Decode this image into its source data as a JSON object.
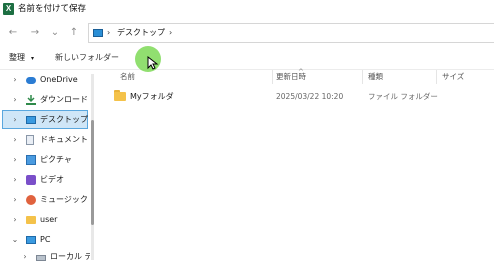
{
  "window": {
    "title": "名前を付けて保存",
    "app_icon_letter": "X"
  },
  "nav": {
    "back_icon": "←",
    "forward_icon": "→",
    "recent_icon": "⌄",
    "up_icon": "↑",
    "breadcrumb": [
      "デスクトップ"
    ],
    "separator": "›"
  },
  "toolbar": {
    "sort_label": "整理",
    "sort_chevron": "▾",
    "new_folder_label": "新しいフォルダー"
  },
  "sidebar": {
    "items": [
      {
        "label": "OneDrive",
        "icon": "cloud-icon",
        "chevron": "›"
      },
      {
        "label": "ダウンロード",
        "icon": "download-icon",
        "chevron": "›"
      },
      {
        "label": "デスクトップ",
        "icon": "desktop-icon",
        "chevron": "›",
        "selected": true
      },
      {
        "label": "ドキュメント",
        "icon": "document-icon",
        "chevron": "›"
      },
      {
        "label": "ピクチャ",
        "icon": "pictures-icon",
        "chevron": "›"
      },
      {
        "label": "ビデオ",
        "icon": "video-icon",
        "chevron": "›"
      },
      {
        "label": "ミュージック",
        "icon": "music-icon",
        "chevron": "›"
      },
      {
        "label": "user",
        "icon": "user-folder-icon",
        "chevron": "›"
      },
      {
        "label": "PC",
        "icon": "pc-icon",
        "chevron": "⌄"
      },
      {
        "label": "ローカル ディスク",
        "icon": "disk-icon",
        "chevron": "›"
      }
    ]
  },
  "list": {
    "columns": [
      "名前",
      "更新日時",
      "種類",
      "サイズ"
    ],
    "sort_indicator": "^",
    "rows": [
      {
        "name": "Myフォルダ",
        "modified": "2025/03/22 10:20",
        "type": "ファイル フォルダー",
        "size": ""
      }
    ]
  },
  "colors": {
    "selected_bg": "#cfe6f7",
    "selected_border": "#5aa7de",
    "folder": "#f4c24a",
    "highlight": "#7ed957"
  }
}
